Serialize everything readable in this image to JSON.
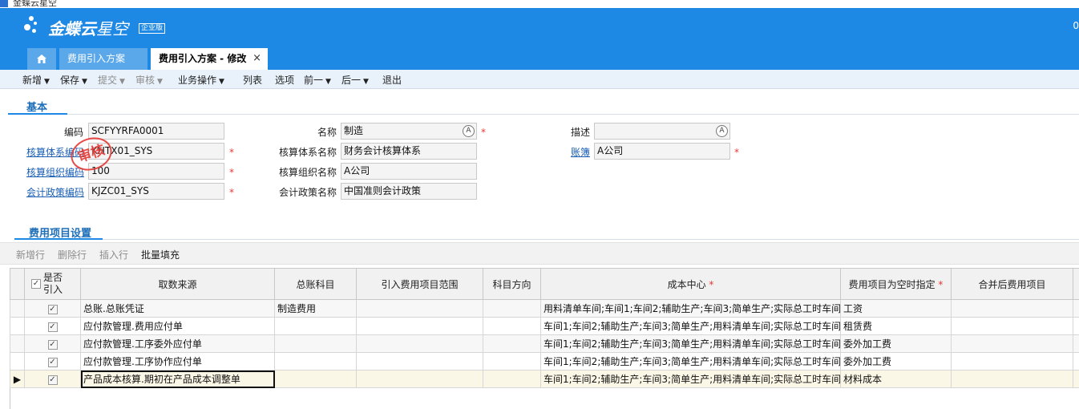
{
  "window": {
    "title": "金蝶云星空"
  },
  "header": {
    "brand_main": "金蝶云",
    "brand_sub": "星空",
    "edition": "企业版",
    "right_text": "0",
    "tabs": [
      {
        "label": "费用引入方案"
      },
      {
        "label": "费用引入方案 - 修改"
      }
    ],
    "close_glyph": "×"
  },
  "toolbar": {
    "items": [
      {
        "label": "新增",
        "dropdown": true,
        "enabled": true
      },
      {
        "label": "保存",
        "dropdown": true,
        "enabled": true
      },
      {
        "label": "提交",
        "dropdown": true,
        "enabled": false
      },
      {
        "label": "审核",
        "dropdown": true,
        "enabled": false
      },
      {
        "label": "业务操作",
        "dropdown": true,
        "enabled": true
      },
      {
        "label": "列表",
        "dropdown": false,
        "enabled": true
      },
      {
        "label": "选项",
        "dropdown": false,
        "enabled": true
      },
      {
        "label": "前一",
        "dropdown": true,
        "enabled": true
      },
      {
        "label": "后一",
        "dropdown": true,
        "enabled": true
      },
      {
        "label": "退出",
        "dropdown": false,
        "enabled": true
      }
    ]
  },
  "basic": {
    "section_title": "基本",
    "fields": {
      "code": {
        "label": "编码",
        "value": "SCFYYRFA0001"
      },
      "acct_system_code": {
        "label": "核算体系编码",
        "value": "KHTX01_SYS"
      },
      "acct_org_code": {
        "label": "核算组织编码",
        "value": "100"
      },
      "policy_code": {
        "label": "会计政策编码",
        "value": "KJZC01_SYS"
      },
      "name": {
        "label": "名称",
        "value": "制造"
      },
      "acct_system_name": {
        "label": "核算体系名称",
        "value": "财务会计核算体系"
      },
      "acct_org_name": {
        "label": "核算组织名称",
        "value": "A公司"
      },
      "policy_name": {
        "label": "会计政策名称",
        "value": "中国准则会计政策"
      },
      "description": {
        "label": "描述",
        "value": ""
      },
      "ledger": {
        "label": "账簿",
        "value": "A公司"
      }
    },
    "required_mark": "*",
    "stamp_text": "审核"
  },
  "expense": {
    "section_title": "费用项目设置",
    "toolbar": [
      {
        "label": "新增行",
        "enabled": false
      },
      {
        "label": "删除行",
        "enabled": false
      },
      {
        "label": "插入行",
        "enabled": false
      },
      {
        "label": "批量填充",
        "enabled": true
      }
    ],
    "columns": {
      "import": "是否引入",
      "source": "取数来源",
      "gl_account": "总账科目",
      "range": "引入费用项目范围",
      "direction": "科目方向",
      "cost_center": "成本中心",
      "empty_item": "费用项目为空时指定",
      "merged_item": "合并后费用项目"
    },
    "rows": [
      {
        "import": true,
        "source": "总账.总账凭证",
        "gl_account": "制造费用",
        "range": "",
        "direction": "",
        "cost_center": "用料清单车间;车间1;车间2;辅助生产;车间3;简单生产;实际总工时车间;",
        "empty_item": "工资",
        "merged_item": ""
      },
      {
        "import": true,
        "source": "应付款管理.费用应付单",
        "gl_account": "",
        "range": "",
        "direction": "",
        "cost_center": "车间1;车间2;辅助生产;车间3;简单生产;用料清单车间;实际总工时车间;",
        "empty_item": "租赁费",
        "merged_item": ""
      },
      {
        "import": true,
        "source": "应付款管理.工序委外应付单",
        "gl_account": "",
        "range": "",
        "direction": "",
        "cost_center": "车间1;车间2;辅助生产;车间3;简单生产;用料清单车间;实际总工时车间;",
        "empty_item": "委外加工费",
        "merged_item": ""
      },
      {
        "import": true,
        "source": "应付款管理.工序协作应付单",
        "gl_account": "",
        "range": "",
        "direction": "",
        "cost_center": "车间1;车间2;辅助生产;车间3;简单生产;用料清单车间;实际总工时车间;",
        "empty_item": "委外加工费",
        "merged_item": ""
      },
      {
        "import": true,
        "source": "产品成本核算.期初在产品成本调整单",
        "gl_account": "",
        "range": "",
        "direction": "",
        "cost_center": "车间1;车间2;辅助生产;车间3;简单生产;用料清单车间;实际总工时车间;",
        "empty_item": "材料成本",
        "merged_item": ""
      }
    ]
  },
  "icons": {
    "home": "home-icon",
    "multilang": "multilang-icon",
    "dropdown": "chevron-down-icon",
    "row_pointer": "row-pointer-icon"
  },
  "colors": {
    "header_bg": "#1e88e5",
    "tab_bg": "#5aa7ea",
    "toolbar_bg": "#e9f2fb",
    "link": "#1a5fb4",
    "required": "#e53935",
    "selected_row": "#fbf7e6"
  }
}
